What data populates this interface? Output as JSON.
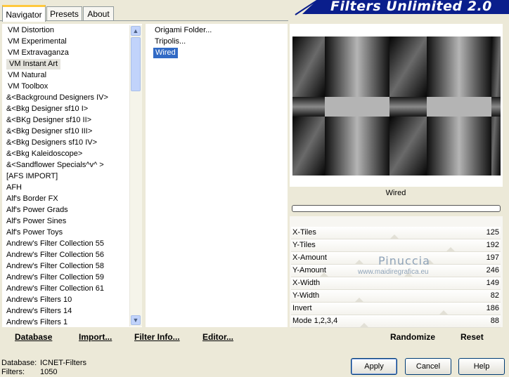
{
  "app": {
    "title": "Filters Unlimited 2.0",
    "brand_color": "#0A1E8C"
  },
  "tabs": [
    {
      "label": "Navigator",
      "active": true
    },
    {
      "label": "Presets",
      "active": false
    },
    {
      "label": "About",
      "active": false
    }
  ],
  "categories": [
    {
      "label": "VM Distortion",
      "selected": false
    },
    {
      "label": "VM Experimental",
      "selected": false
    },
    {
      "label": "VM Extravaganza",
      "selected": false
    },
    {
      "label": "VM Instant Art",
      "selected": true
    },
    {
      "label": "VM Natural",
      "selected": false
    },
    {
      "label": "VM Toolbox",
      "selected": false
    },
    {
      "label": "&<Background Designers IV>",
      "selected": false
    },
    {
      "label": "&<Bkg Designer sf10 I>",
      "selected": false
    },
    {
      "label": "&<BKg Designer sf10 II>",
      "selected": false
    },
    {
      "label": "&<Bkg Designer sf10 III>",
      "selected": false
    },
    {
      "label": "&<Bkg Designers sf10 IV>",
      "selected": false
    },
    {
      "label": "&<Bkg Kaleidoscope>",
      "selected": false
    },
    {
      "label": "&<Sandflower Specials^v^ >",
      "selected": false
    },
    {
      "label": "[AFS IMPORT]",
      "selected": false
    },
    {
      "label": "AFH",
      "selected": false
    },
    {
      "label": "Alf's Border FX",
      "selected": false
    },
    {
      "label": "Alf's Power Grads",
      "selected": false
    },
    {
      "label": "Alf's Power Sines",
      "selected": false
    },
    {
      "label": "Alf's Power Toys",
      "selected": false
    },
    {
      "label": "Andrew's Filter Collection 55",
      "selected": false
    },
    {
      "label": "Andrew's Filter Collection 56",
      "selected": false
    },
    {
      "label": "Andrew's Filter Collection 58",
      "selected": false
    },
    {
      "label": "Andrew's Filter Collection 59",
      "selected": false
    },
    {
      "label": "Andrew's Filter Collection 61",
      "selected": false
    },
    {
      "label": "Andrew's Filters 10",
      "selected": false
    },
    {
      "label": "Andrew's Filters 14",
      "selected": false
    },
    {
      "label": "Andrew's Filters 1",
      "selected": false
    }
  ],
  "scrollbar": {
    "up_icon": "arrow-up-icon",
    "down_icon": "arrow-down-icon"
  },
  "filters": [
    {
      "label": "Origami Folder...",
      "selected": false
    },
    {
      "label": "Tripolis...",
      "selected": false
    },
    {
      "label": "Wired",
      "selected": true
    }
  ],
  "toolbar": {
    "database_label": "Database",
    "import_label": "Import...",
    "filter_info_label": "Filter Info...",
    "editor_label": "Editor..."
  },
  "preview": {
    "label": "Wired",
    "progress": 0
  },
  "watermark": {
    "name": "Pinuccia",
    "url": "www.maidiregrafica.eu"
  },
  "params": [
    {
      "name": "X-Tiles",
      "value": "125"
    },
    {
      "name": "Y-Tiles",
      "value": "192"
    },
    {
      "name": "X-Amount",
      "value": "197"
    },
    {
      "name": "Y-Amount",
      "value": "246"
    },
    {
      "name": "X-Width",
      "value": "149"
    },
    {
      "name": "Y-Width",
      "value": "82"
    },
    {
      "name": "Invert",
      "value": "186"
    },
    {
      "name": "Mode 1,2,3,4",
      "value": "88"
    }
  ],
  "param_actions": {
    "randomize_label": "Randomize",
    "reset_label": "Reset"
  },
  "status": {
    "database_label": "Database:",
    "database_value": "ICNET-Filters",
    "filters_label": "Filters:",
    "filters_value": "1050"
  },
  "buttons": {
    "apply": "Apply",
    "cancel": "Cancel",
    "help": "Help"
  }
}
